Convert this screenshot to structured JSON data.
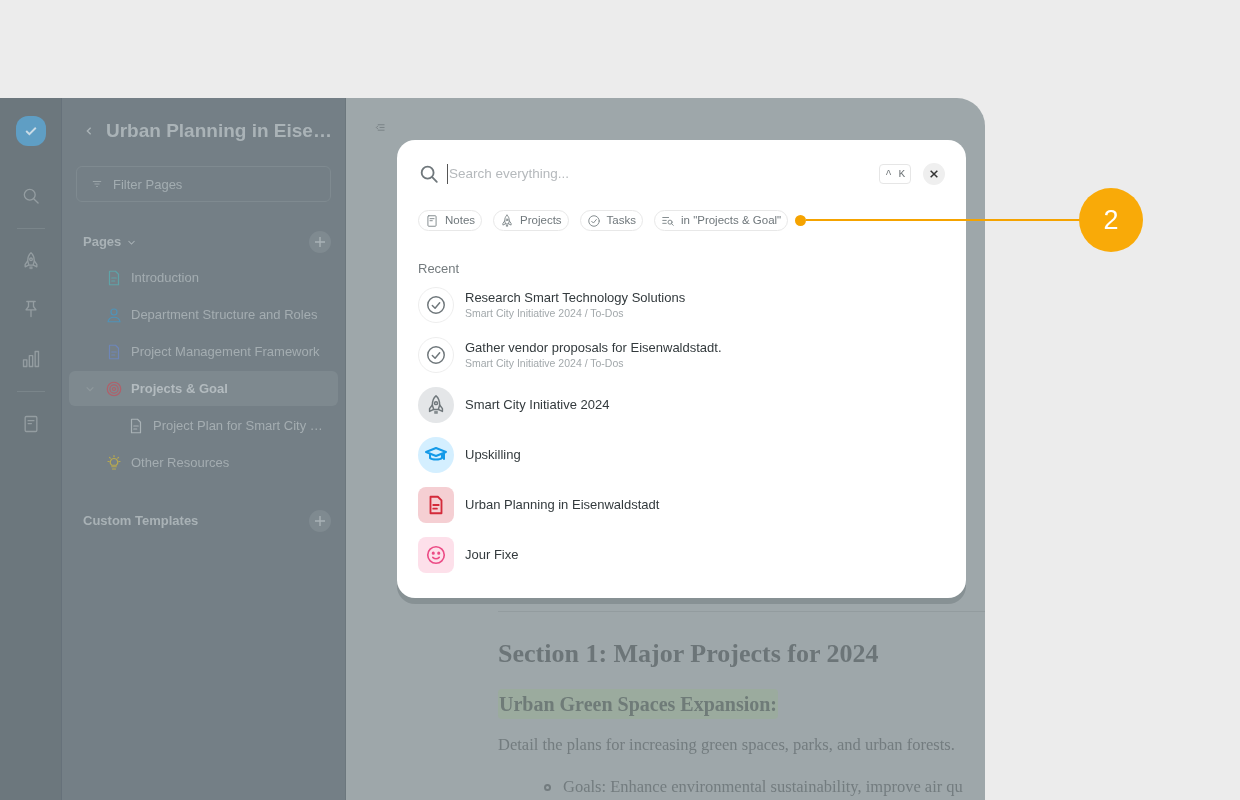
{
  "sidebar": {
    "title": "Urban Planning in Eise…",
    "filter": {
      "placeholder": "Filter Pages"
    },
    "pages": {
      "label": "Pages",
      "expanded": true,
      "items": [
        {
          "label": "Introduction",
          "kind": "doc",
          "color": "#5fa3a8",
          "selected": false
        },
        {
          "label": "Department Structure and Roles",
          "kind": "person",
          "color": "#4f93b8",
          "selected": false
        },
        {
          "label": "Project Management Framework",
          "kind": "doc",
          "color": "#6e86b8",
          "selected": false
        },
        {
          "label": "Projects & Goal",
          "kind": "target",
          "color": "#b0606a",
          "selected": true,
          "expanded": true,
          "children": [
            {
              "label": "Project Plan for Smart City …",
              "kind": "doc",
              "color": "#a9b2b6",
              "selected": false
            }
          ]
        },
        {
          "label": "Other Resources",
          "kind": "bulb",
          "color": "#b8a94f",
          "selected": false
        }
      ]
    },
    "custom_templates": {
      "label": "Custom Templates"
    }
  },
  "search_dialog": {
    "placeholder": "Search everything...",
    "shortcut": "^ K",
    "filters": [
      {
        "label": "Notes",
        "kind": "note"
      },
      {
        "label": "Projects",
        "kind": "rocket"
      },
      {
        "label": "Tasks",
        "kind": "task"
      },
      {
        "label": "in \"Projects & Goal\"",
        "kind": "scope"
      }
    ],
    "section": "Recent",
    "results": [
      {
        "title": "Research Smart Technology Solutions",
        "subtitle": "Smart City Initiative 2024 / To-Dos",
        "kind": "task"
      },
      {
        "title": "Gather vendor proposals for Eisenwaldstadt.",
        "subtitle": "Smart City Initiative 2024 / To-Dos",
        "kind": "task"
      },
      {
        "title": "Smart City Initiative 2024",
        "kind": "project"
      },
      {
        "title": "Upskilling",
        "kind": "course"
      },
      {
        "title": "Urban Planning in Eisenwaldstadt",
        "kind": "document"
      },
      {
        "title": "Jour Fixe",
        "kind": "meeting"
      }
    ]
  },
  "document": {
    "heading": "Section 1: Major Projects for 2024",
    "subheading": "Urban Green Spaces Expansion:",
    "paragraph": "Detail the plans for increasing green spaces, parks, and urban forests.",
    "bullets": [
      "Goals: Enhance environmental sustainability, improve air qu"
    ]
  },
  "callout": {
    "label": "2"
  }
}
